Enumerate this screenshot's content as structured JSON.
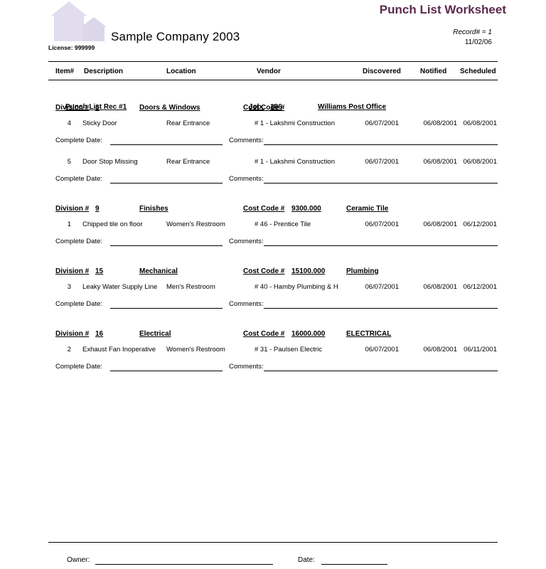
{
  "header": {
    "company_name": "Sample Company 2003",
    "license": "License: 999999",
    "doc_title": "Punch List Worksheet",
    "record_number": "Record# = 1",
    "doc_date": "11/02/06",
    "logo_color": "#e1dcee",
    "title_color": "#5c2a4c"
  },
  "columns": {
    "item": "Item#",
    "description": "Description",
    "location": "Location",
    "vendor": "Vendor",
    "discovered": "Discovered",
    "notified": "Notified",
    "scheduled": "Scheduled"
  },
  "record": {
    "title": "Punch List Rec #1",
    "job_label": "Job:",
    "job_number": "186",
    "job_name": "Williams Post Office"
  },
  "labels": {
    "division": "Division #",
    "cost_code": "Cost Code #",
    "complete_date": "Complete Date:",
    "comments": "Comments:",
    "owner": "Owner:",
    "date": "Date:"
  },
  "divisions": [
    {
      "number": "8",
      "name": "Doors & Windows",
      "cost_code_number": "",
      "cost_code_name": "",
      "items": [
        {
          "item": "4",
          "description": "Sticky Door",
          "location": "Rear Entrance",
          "vendor": "# 1 - Lakshmi Construction",
          "discovered": "06/07/2001",
          "notified": "06/08/2001",
          "scheduled": "06/08/2001"
        },
        {
          "item": "5",
          "description": "Door Stop Missing",
          "location": "Rear Entrance",
          "vendor": "# 1 - Lakshmi Construction",
          "discovered": "06/07/2001",
          "notified": "06/08/2001",
          "scheduled": "06/08/2001"
        }
      ]
    },
    {
      "number": "9",
      "name": "Finishes",
      "cost_code_number": "9300.000",
      "cost_code_name": "Ceramic Tile",
      "items": [
        {
          "item": "1",
          "description": "Chipped tile on floor",
          "location": "Women's Restroom",
          "vendor": "# 46 - Prentice Tile",
          "discovered": "06/07/2001",
          "notified": "06/08/2001",
          "scheduled": "06/12/2001"
        }
      ]
    },
    {
      "number": "15",
      "name": "Mechanical",
      "cost_code_number": "15100.000",
      "cost_code_name": "Plumbing",
      "items": [
        {
          "item": "3",
          "description": "Leaky Water Supply Line",
          "location": "Men's Restroom",
          "vendor": "# 40 - Hamby Plumbing & H",
          "discovered": "06/07/2001",
          "notified": "06/08/2001",
          "scheduled": "06/12/2001"
        }
      ]
    },
    {
      "number": "16",
      "name": "Electrical",
      "cost_code_number": "16000.000",
      "cost_code_name": "ELECTRICAL",
      "items": [
        {
          "item": "2",
          "description": "Exhaust Fan Inoperative",
          "location": "Women's Restroom",
          "vendor": "# 31 - Paulsen Electric",
          "discovered": "06/07/2001",
          "notified": "06/08/2001",
          "scheduled": "06/11/2001"
        }
      ]
    }
  ]
}
